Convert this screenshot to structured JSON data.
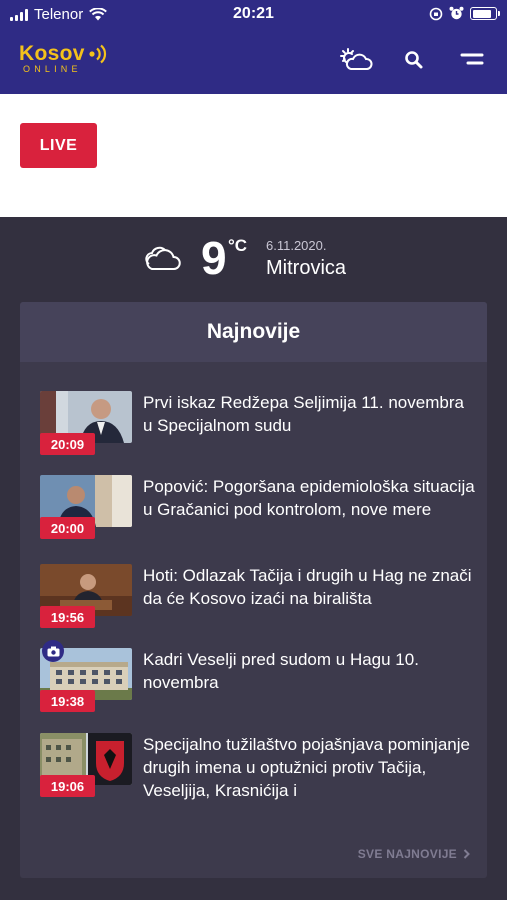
{
  "status_bar": {
    "carrier": "Telenor",
    "time": "20:21",
    "battery_level": 0.85
  },
  "header": {
    "logo_main": "Kosov",
    "logo_sub": "ONLINE",
    "icons": [
      "weather-sun-cloud-icon",
      "search-icon",
      "menu-icon"
    ],
    "colors": {
      "background": "#2f2b85",
      "logo": "#f4c21b"
    }
  },
  "live": {
    "label": "LIVE",
    "color": "#d9223d"
  },
  "weather": {
    "temperature": "9",
    "unit": "°C",
    "date": "6.11.2020.",
    "city": "Mitrovica",
    "icon": "cloud-icon"
  },
  "news": {
    "title": "Najnovije",
    "items": [
      {
        "time": "20:09",
        "headline": "Prvi iskaz Redžepa Seljimija 11. novembra u Specijalnom sudu",
        "photo_badge": false
      },
      {
        "time": "20:00",
        "headline": "Popović: Pogoršana epidemiološka situacija u Gračanici pod kontrolom, nove mere",
        "photo_badge": false
      },
      {
        "time": "19:56",
        "headline": "Hoti: Odlazak Tačija i drugih u Hag ne znači da će Kosovo izaći na birališta",
        "photo_badge": false
      },
      {
        "time": "19:38",
        "headline": "Kadri Veselji pred sudom u Hagu 10. novembra",
        "photo_badge": true
      },
      {
        "time": "19:06",
        "headline": "Specijalno tužilaštvo pojašnjava pominjanje drugih imena u optužnici protiv Tačija, Veseljija, Krasnićija i",
        "photo_badge": false
      }
    ],
    "more_label": "SVE NAJNOVIJE"
  }
}
